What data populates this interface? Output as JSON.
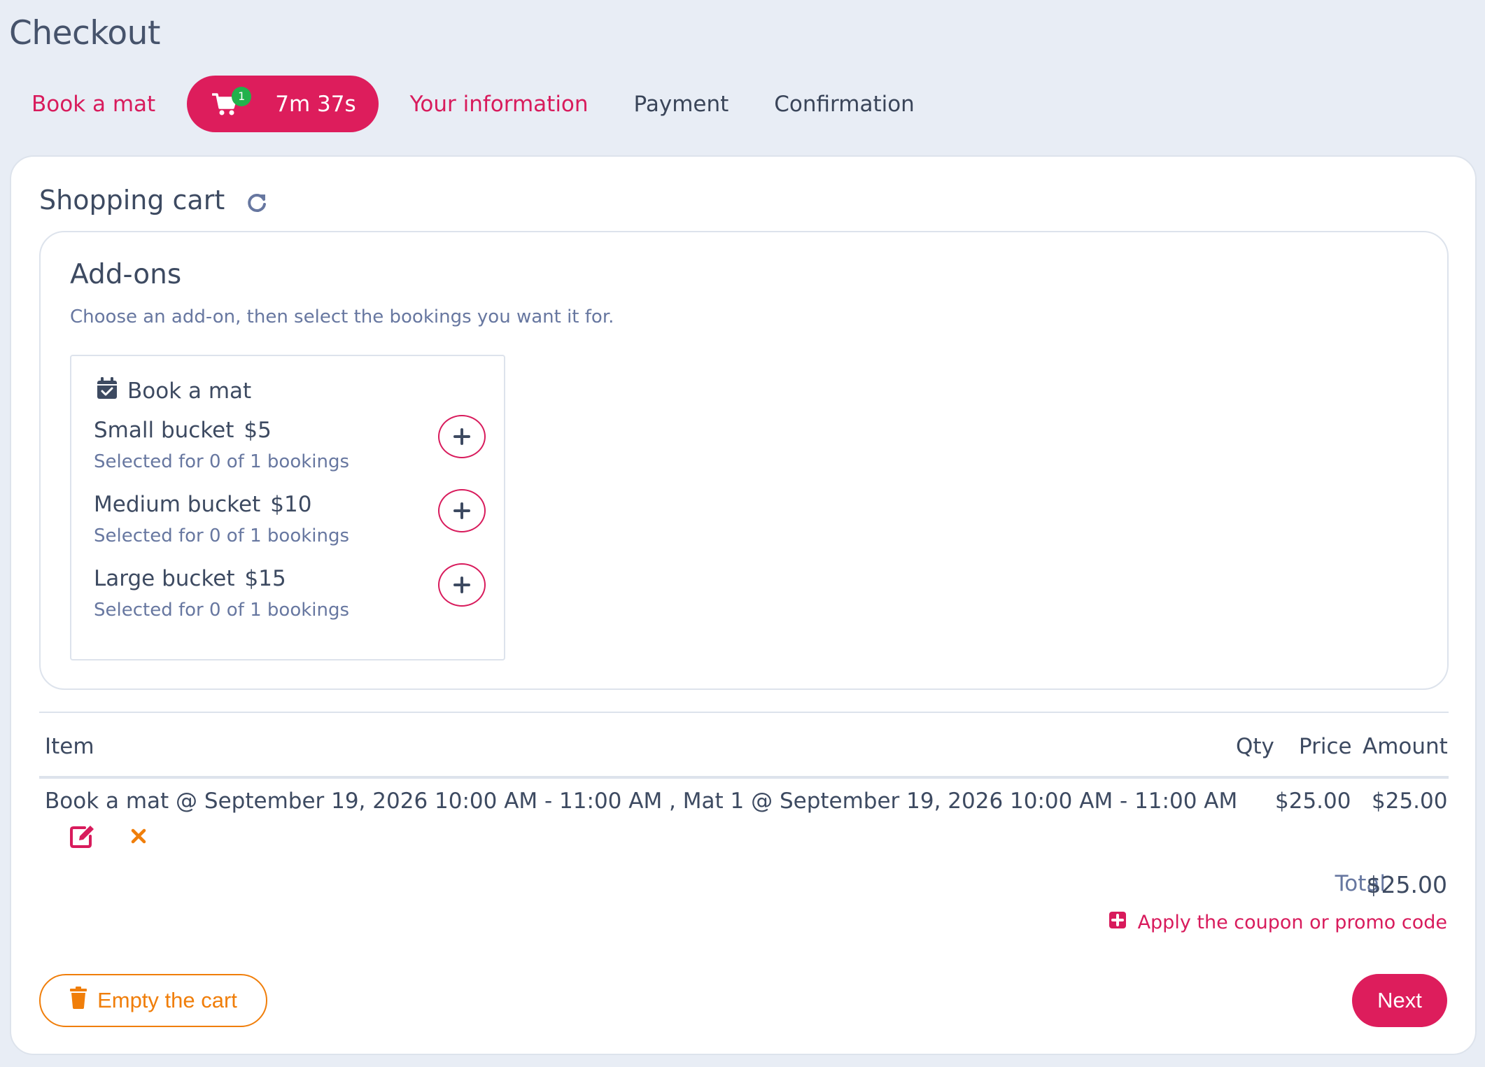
{
  "page": {
    "title": "Checkout"
  },
  "steps": {
    "book_mat": "Book a mat",
    "cart_count": "1",
    "timer": "7m 37s",
    "your_information": "Your information",
    "payment": "Payment",
    "confirmation": "Confirmation"
  },
  "cart": {
    "title": "Shopping cart",
    "addons": {
      "title": "Add-ons",
      "subtitle": "Choose an add-on, then select the bookings you want it for.",
      "group_label": "Book a mat",
      "items": [
        {
          "name": "Small bucket",
          "price": "$5",
          "selected": "Selected for 0 of 1 bookings"
        },
        {
          "name": "Medium bucket",
          "price": "$10",
          "selected": "Selected for 0 of 1 bookings"
        },
        {
          "name": "Large bucket",
          "price": "$15",
          "selected": "Selected for 0 of 1 bookings"
        }
      ]
    },
    "table": {
      "headers": {
        "item": "Item",
        "qty": "Qty",
        "price": "Price",
        "amount": "Amount"
      },
      "rows": [
        {
          "item": "Book a mat @ September 19, 2026 10:00 AM - 11:00 AM , Mat 1 @ September 19, 2026 10:00 AM - 11:00 AM",
          "qty": "",
          "price": "$25.00",
          "amount": "$25.00"
        }
      ]
    },
    "total_label": "Total",
    "total_value": "$25.00",
    "coupon_link": "Apply the coupon or promo code",
    "empty_button": "Empty the cart",
    "next_button": "Next"
  },
  "colors": {
    "accent": "#dd1d5c",
    "warning": "#f07e0a",
    "badge": "#22b14c",
    "background": "#e8edf5"
  }
}
